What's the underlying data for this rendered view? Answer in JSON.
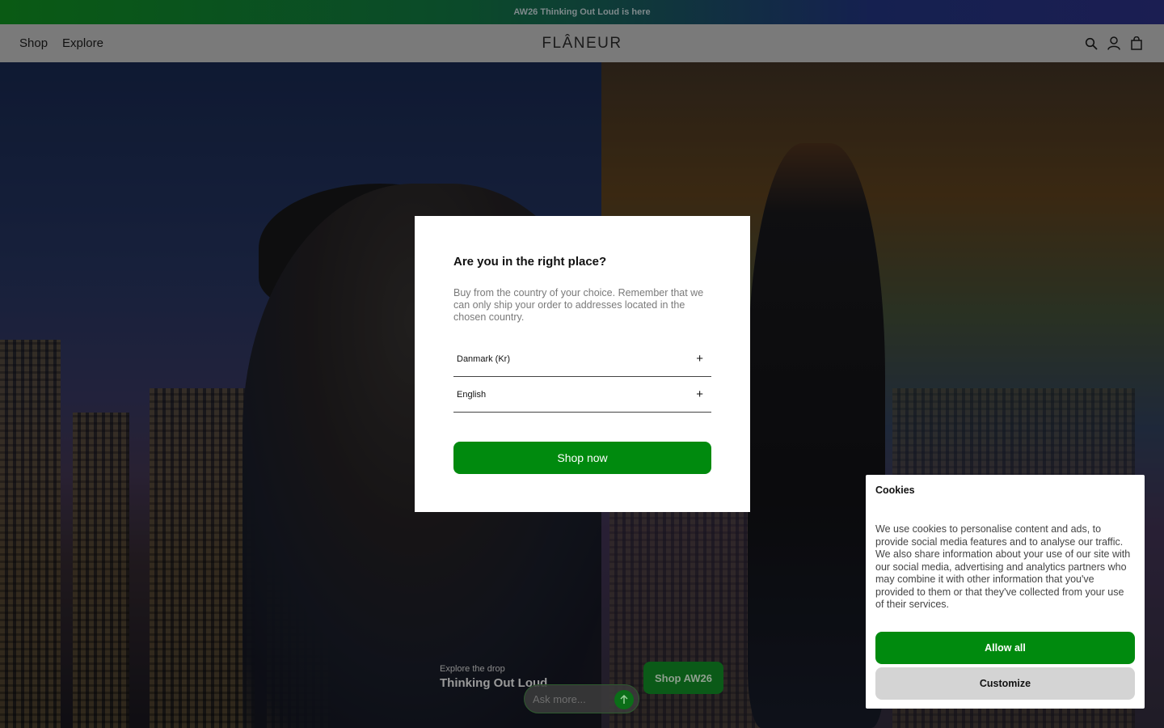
{
  "announcement": {
    "text": "AW26 Thinking Out Loud is here"
  },
  "header": {
    "nav": [
      "Shop",
      "Explore"
    ],
    "logo": "FLÂNEUR",
    "icons": [
      "search-icon",
      "account-icon",
      "bag-icon"
    ]
  },
  "hero": {
    "eyebrow": "Explore the drop",
    "title": "Thinking Out Loud",
    "cta": "Shop AW26",
    "ask_placeholder": "Ask more..."
  },
  "modal": {
    "title": "Are you in the right place?",
    "description": "Buy from the country of your choice. Remember that we can only ship your order to addresses located in the chosen country.",
    "country": "Danmark (Kr)",
    "language": "English",
    "button": "Shop now"
  },
  "cookies": {
    "title": "Cookies",
    "text": "We use cookies to personalise content and ads, to provide social media features and to analyse our traffic. We also share information about your use of our site with our social media, advertising and analytics partners who may combine it with other information that you've provided to them or that they've collected from your use of their services.",
    "allow_label": "Allow all",
    "customize_label": "Customize"
  },
  "colors": {
    "accent": "#008a0e"
  }
}
